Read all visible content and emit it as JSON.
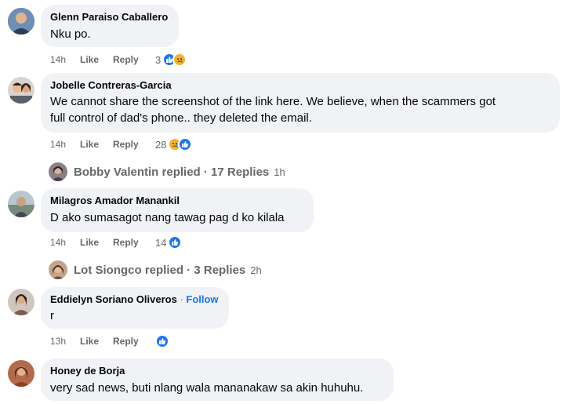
{
  "comments": [
    {
      "author": "Glenn Paraiso Caballero",
      "text": "Nku po.",
      "time": "14h",
      "like": "Like",
      "reply": "Reply",
      "reaction_count": "3"
    },
    {
      "author": "Jobelle Contreras-Garcia",
      "text_line1": "We cannot share the screenshot of the link here. We believe, when the scammers got",
      "text_line2": "full control of dad's phone.. they deleted the email.",
      "time": "14h",
      "like": "Like",
      "reply": "Reply",
      "reaction_count": "28"
    },
    {
      "author": "Milagros Amador Manankil",
      "text": "D ako sumasagot nang tawag pag d ko kilala",
      "time": "14h",
      "like": "Like",
      "reply": "Reply",
      "reaction_count": "14"
    },
    {
      "author": "Eddielyn Soriano Oliveros",
      "follow_sep": " · ",
      "follow": "Follow",
      "text": "r",
      "time": "13h",
      "like": "Like",
      "reply": "Reply"
    },
    {
      "author": "Honey de Borja",
      "text": "very sad news, buti nlang wala mananakaw sa akin huhuhu."
    }
  ],
  "reply_threads": [
    {
      "who": "Bobby Valentin replied",
      "sep": " · ",
      "count": "17 Replies",
      "ago": "1h"
    },
    {
      "who": "Lot Siongco replied",
      "sep": " · ",
      "count": "3 Replies",
      "ago": "2h"
    }
  ],
  "colors": {
    "bubble": "#f0f2f5",
    "meta": "#65676b",
    "accent": "#1877f2",
    "sad": "#f7b125"
  },
  "icons": [
    "like-reaction-icon",
    "sad-reaction-icon",
    "avatar"
  ]
}
